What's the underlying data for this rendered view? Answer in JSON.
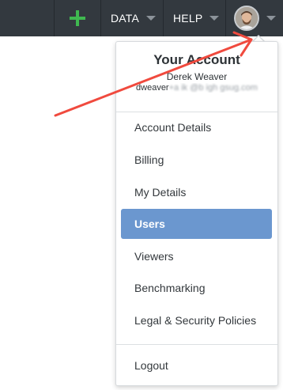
{
  "topbar": {
    "add_icon": "plus-icon",
    "add_color": "#3fb950",
    "data_label": "DATA",
    "help_label": "HELP",
    "background": "#33393f"
  },
  "account_menu": {
    "title": "Your Account",
    "user_name": "Derek Weaver",
    "email_visible": "dweaver",
    "email_obscured": "+a ik @b igh gsug.com",
    "items": [
      {
        "label": "Account Details",
        "active": false
      },
      {
        "label": "Billing",
        "active": false
      },
      {
        "label": "My Details",
        "active": false
      },
      {
        "label": "Users",
        "active": true
      },
      {
        "label": "Viewers",
        "active": false
      },
      {
        "label": "Benchmarking",
        "active": false
      },
      {
        "label": "Legal & Security Policies",
        "active": false
      },
      {
        "label": "Logout",
        "active": false
      }
    ],
    "active_color": "#6b97cf"
  },
  "annotation": {
    "arrow_color": "#f04a3e"
  }
}
